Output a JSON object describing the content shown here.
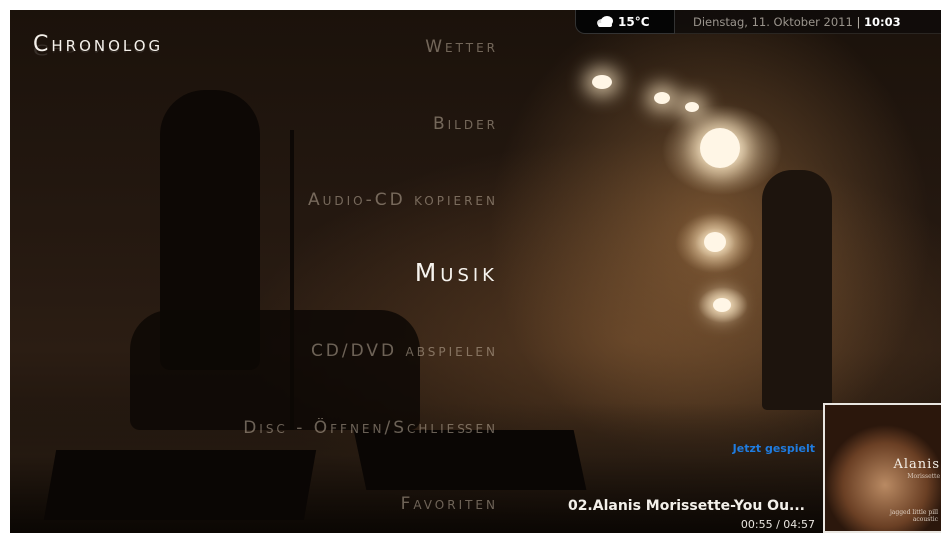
{
  "app": {
    "title": "Chronolog"
  },
  "topbar": {
    "weather_icon": "cloud-icon",
    "temperature": "15°C",
    "date": "Dienstag, 11. Oktober 2011",
    "separator": "|",
    "time": "10:03"
  },
  "menu": {
    "items": [
      {
        "label": "Wetter",
        "active": false
      },
      {
        "label": "Bilder",
        "active": false
      },
      {
        "label": "Audio-CD kopieren",
        "active": false
      },
      {
        "label": "Musik",
        "active": true
      },
      {
        "label": "CD/DVD abspielen",
        "active": false
      },
      {
        "label": "Disc - Öffnen/Schließen",
        "active": false
      },
      {
        "label": "Favoriten",
        "active": false
      }
    ]
  },
  "now_playing": {
    "label": "Jetzt gespielt",
    "track": "02.Alanis Morissette-You Ou...",
    "elapsed": "00:55",
    "time_sep": "/",
    "duration": "04:57",
    "album_art": {
      "artist_text": "Alanis",
      "album_text": "Morissette",
      "foot_line1": "jagged little pill",
      "foot_line2": "acoustic"
    }
  },
  "colors": {
    "accent_blue": "#1f7ce0",
    "menu_inactive": "#dccdb9",
    "menu_active": "#f6f3ee"
  }
}
